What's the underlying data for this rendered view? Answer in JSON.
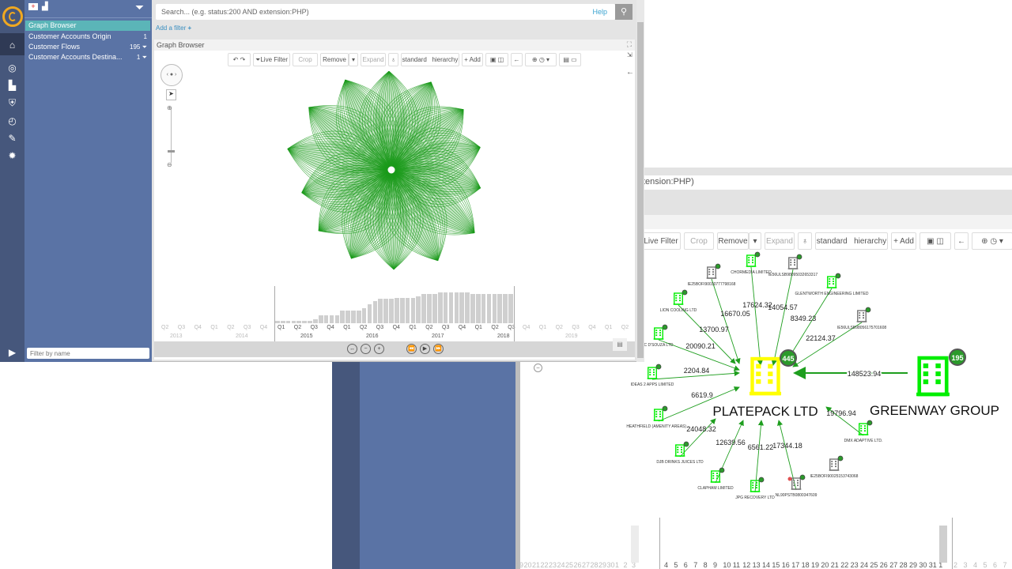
{
  "sidebar": {
    "toolbar_icons": [
      "add-dashboard-icon",
      "chart-icon"
    ],
    "filter_icon": "funnel-icon",
    "items": [
      {
        "label": "Graph Browser",
        "count": "",
        "selected": true
      },
      {
        "label": "Customer Accounts Origin",
        "count": "1"
      },
      {
        "label": "Customer Flows",
        "count": "195",
        "filter": true
      },
      {
        "label": "Customer Accounts Destina...",
        "count": "1",
        "filter": true
      }
    ],
    "nav_icons": [
      "home-icon",
      "compass-icon",
      "bar-chart-icon",
      "shield-icon",
      "history-icon",
      "wrench-icon",
      "gear-icon"
    ],
    "play_icon": "play-circle-icon",
    "filter_placeholder": "Filter by name",
    "colors": {
      "dark": "#46577c",
      "panel": "#5a73a5",
      "selected": "#5bb5b8",
      "logo": "#f0a820"
    }
  },
  "search": {
    "placeholder": "Search... (e.g. status:200 AND extension:PHP)",
    "help": "Help",
    "add_filter": "Add a filter",
    "partial_text": "tension:PHP)"
  },
  "panel": {
    "title": "Graph Browser"
  },
  "toolbar": {
    "undo": "↶",
    "redo": "↷",
    "live_filter": "Live Filter",
    "crop": "Crop",
    "remove": "Remove",
    "expand": "Expand",
    "layout_standard": "standard",
    "layout_hierarchy": "hierarchy",
    "add": "+ Add"
  },
  "timeline": {
    "quarter_labels_dim_left": [
      "Q2",
      "Q3",
      "Q4",
      "Q1",
      "Q2",
      "Q3",
      "Q4"
    ],
    "quarter_labels": [
      "Q1",
      "Q2",
      "Q3",
      "Q4",
      "Q1",
      "Q2",
      "Q3",
      "Q4",
      "Q1",
      "Q2",
      "Q3",
      "Q4",
      "Q1",
      "Q2",
      "Q3"
    ],
    "quarter_labels_dim_right": [
      "Q4",
      "Q1",
      "Q2",
      "Q3",
      "Q4",
      "Q1",
      "Q2"
    ],
    "years_dim_left": [
      "2013",
      "2014"
    ],
    "years": [
      "2015",
      "2016",
      "2017",
      "2018"
    ],
    "years_dim_right": [
      "2019"
    ],
    "bar_values": [
      2,
      2,
      2,
      2,
      2,
      2,
      2,
      5,
      10,
      10,
      10,
      10,
      17,
      17,
      17,
      17,
      20,
      26,
      30,
      33,
      33,
      33,
      35,
      35,
      35,
      35,
      37,
      40,
      40,
      40,
      42,
      42,
      42,
      42,
      42,
      42,
      40,
      40,
      40,
      40,
      40,
      40,
      40,
      40
    ],
    "controls": [
      "fit-width-icon",
      "zoom-out-icon",
      "zoom-in-icon",
      "rewind-icon",
      "play-icon",
      "fast-forward-icon"
    ],
    "day_labels_dim_left": [
      "19",
      "20",
      "21",
      "22",
      "23",
      "24",
      "25",
      "26",
      "27",
      "28",
      "29",
      "30",
      "1",
      "2",
      "3"
    ],
    "day_labels": [
      "4",
      "5",
      "6",
      "7",
      "8",
      "9",
      "10",
      "11",
      "12",
      "13",
      "14",
      "15",
      "16",
      "17",
      "18",
      "19",
      "20",
      "21",
      "22",
      "23",
      "24",
      "25",
      "26",
      "27",
      "28",
      "29",
      "30",
      "31",
      "1"
    ],
    "day_labels_dim_right": [
      "2",
      "3",
      "4",
      "5",
      "6",
      "7"
    ]
  },
  "graph": {
    "center": {
      "label": "PLATEPACK LTD",
      "badge": "445",
      "color": "#ffff00"
    },
    "source": {
      "label": "GREENWAY GROUP",
      "badge": "195",
      "color": "#00ee00",
      "amount": "148523.94"
    },
    "nodes": [
      {
        "label": "IE25BOFI90030777798168",
        "type": "gray",
        "amount": "16670.05"
      },
      {
        "label": "CHORMEDIA LIMITED",
        "type": "green",
        "amount": "17624.32"
      },
      {
        "label": "IE56ULSB98095032653317",
        "type": "gray",
        "amount": "14054.57"
      },
      {
        "label": "GLENTWORTH ENGINEERING LIMITED",
        "type": "green",
        "amount": "8349.23"
      },
      {
        "label": "LION COOLING LTD",
        "type": "green",
        "amount": "13700.97"
      },
      {
        "label": "IE56ULSB98056175701608",
        "type": "gray",
        "amount": "22124.37"
      },
      {
        "label": "C D'SOUZA LTD",
        "type": "green",
        "amount": "20090.21"
      },
      {
        "label": "IDEAS 2 APPS LIMITED",
        "type": "green",
        "amount": "2204.84"
      },
      {
        "label": "HEATHFIELD (AMENITY AREAS) ...",
        "type": "green",
        "amount": "6619.9"
      },
      {
        "label": "DJB DRINKS JUICES  LTD",
        "type": "green",
        "amount": "24048.32"
      },
      {
        "label": "CLAPHAM LIMITED",
        "type": "green",
        "amount": "12639.56"
      },
      {
        "label": "JPG RECOVERY LTD",
        "type": "green",
        "amount": "6561.22"
      },
      {
        "label": "NL90PSTB0800347609",
        "type": "gray",
        "amount": "17344.18",
        "alert": true
      },
      {
        "label": "IE25BOFI90025153743068",
        "type": "gray",
        "amount": ""
      },
      {
        "label": "DMX ADAPTIVE LTD.",
        "type": "green",
        "amount": "19796.94"
      }
    ],
    "colors": {
      "edge": "#1e9e1e",
      "green_node": "#00ee00",
      "gray_node": "#777777",
      "flower": "#1a9a1a"
    }
  }
}
